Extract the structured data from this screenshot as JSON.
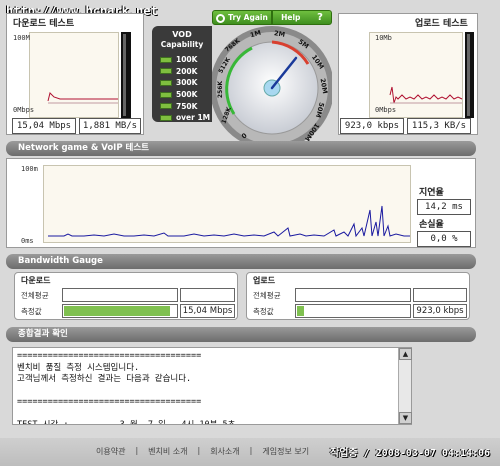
{
  "watermark": "http://www.bcpark.net",
  "download": {
    "title": "다운로드 테스트",
    "axis_top": "100M",
    "axis_bottom": "0Mbps",
    "speed_mbps": "15,04 Mbps",
    "speed_mbs": "1,881 MB/s"
  },
  "upload": {
    "title": "업로드 테스트",
    "axis_top": "10Mb",
    "axis_bottom": "0Mbps",
    "speed_kbps": "923,0 kbps",
    "speed_kbs": "115,3 KB/s"
  },
  "vod": {
    "title": "VOD",
    "subtitle": "Capability",
    "levels": [
      "100K",
      "200K",
      "300K",
      "500K",
      "750K",
      "over 1M"
    ]
  },
  "gauge": {
    "try_again": "Try Again",
    "help": "Help",
    "help_icon": "?",
    "ticks": [
      "0",
      "128K",
      "256K",
      "512K",
      "768K",
      "1M",
      "2M",
      "5M",
      "10M",
      "20M",
      "50M",
      "100M"
    ]
  },
  "network": {
    "section_title": "Network game & VoIP 테스트",
    "axis_top": "100m",
    "axis_bottom": "0ms",
    "latency_label": "지연율",
    "latency_value": "14,2 ms",
    "loss_label": "손실율",
    "loss_value": "0,0 %"
  },
  "bandwidth": {
    "section_title": "Bandwidth Gauge",
    "download_label": "다운로드",
    "upload_label": "업로드",
    "avg_label": "전체평균",
    "measured_label": "측정값",
    "download_value": "15,04 Mbps",
    "upload_value": "923,0 kbps",
    "download_fill": 0.95,
    "upload_fill": 0.06
  },
  "report": {
    "section_title": "종합결과 확인",
    "lines": [
      "====================================",
      "벤치비 품질 측정 시스템입니다.",
      "고객님께서 측정하신 결과는 다음과 같습니다.",
      "",
      "====================================",
      "",
      "TEST 시각 :          3 월  7 일   4시 10분 5초"
    ]
  },
  "footer": {
    "links": [
      "이용약관",
      "벤치비 소개",
      "회사소개",
      "게임정보 보기"
    ],
    "stamp": "작업중 / 2008-03-07 04:14:06"
  },
  "colors": {
    "graph_line": "#b01030",
    "network_line": "#1a1aa0",
    "bar_fill": "#7fc050",
    "gauge_needle": "#1a3a9a"
  }
}
